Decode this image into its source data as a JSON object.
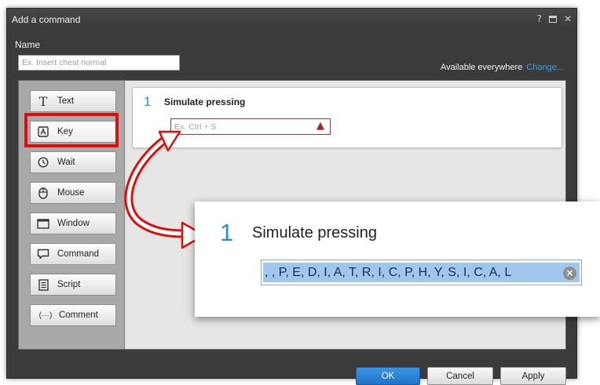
{
  "window": {
    "title": "Add a command",
    "help_glyph": "?",
    "close_glyph": "✕"
  },
  "name_section": {
    "label": "Name",
    "placeholder": "Ex. Insert chest normal",
    "availability": "Available everywhere",
    "change_link": "Change..."
  },
  "commands": [
    {
      "label": "Text",
      "icon": "text-icon",
      "glyph": "T"
    },
    {
      "label": "Key",
      "icon": "key-icon",
      "glyph": "A"
    },
    {
      "label": "Wait",
      "icon": "clock-icon",
      "glyph": "◷"
    },
    {
      "label": "Mouse",
      "icon": "mouse-icon",
      "glyph": "⌓"
    },
    {
      "label": "Window",
      "icon": "window-icon",
      "glyph": "▭"
    },
    {
      "label": "Command",
      "icon": "speech-bubble-icon",
      "glyph": "▢"
    },
    {
      "label": "Script",
      "icon": "script-icon",
      "glyph": "≣"
    },
    {
      "label": "Comment",
      "icon": "comment-icon",
      "glyph": "(···)"
    }
  ],
  "step": {
    "number": "1",
    "title": "Simulate pressing",
    "placeholder": "Ex. Ctrl + S",
    "warning_icon": "warning-icon"
  },
  "zoom": {
    "number": "1",
    "title": "Simulate pressing",
    "value": ", , P, E, D, I, A, T, R, I, C, P, H, Y, S, I, C, A, L"
  },
  "buttons": {
    "ok": "OK",
    "cancel": "Cancel",
    "apply": "Apply"
  },
  "colors": {
    "accent": "#2b8ad8",
    "highlight": "#e00d0d",
    "warning": "#b01e2a"
  }
}
